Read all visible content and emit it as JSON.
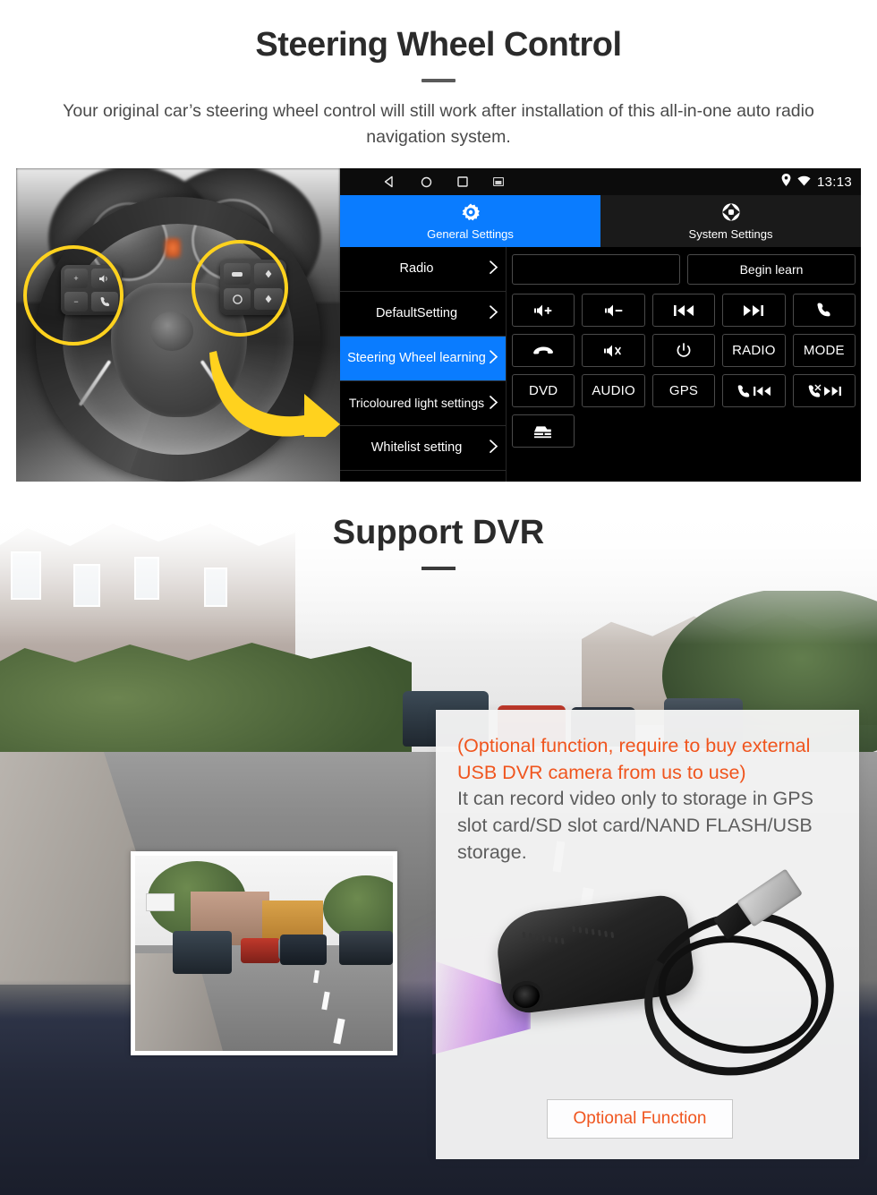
{
  "steering_section": {
    "title": "Steering Wheel Control",
    "description": "Your original car’s steering wheel control will still work after installation of this all-in-one auto radio navigation system.",
    "photo_alt": "steering-wheel-photo"
  },
  "head_unit": {
    "statusbar": {
      "nav_back": "back-icon",
      "nav_home": "home-icon",
      "nav_recents": "recents-icon",
      "nav_screenshot": "screenshot-icon",
      "location_icon": "location-pin-icon",
      "wifi_icon": "wifi-icon",
      "time": "13:13"
    },
    "tabs": [
      {
        "label": "General Settings",
        "icon": "gear-icon",
        "active": true
      },
      {
        "label": "System Settings",
        "icon": "aperture-icon",
        "active": false
      }
    ],
    "menu": [
      {
        "label": "Radio",
        "selected": false
      },
      {
        "label": "DefaultSetting",
        "selected": false
      },
      {
        "label": "Steering Wheel learning",
        "selected": true
      },
      {
        "label": "Tricoloured light settings",
        "selected": false
      },
      {
        "label": "Whitelist setting",
        "selected": false
      }
    ],
    "panel": {
      "input_value": "",
      "input_placeholder": "",
      "begin_learn_label": "Begin learn",
      "keys": [
        {
          "label": "",
          "icon": "volume-up-icon"
        },
        {
          "label": "",
          "icon": "volume-down-icon"
        },
        {
          "label": "",
          "icon": "previous-track-icon"
        },
        {
          "label": "",
          "icon": "next-track-icon"
        },
        {
          "label": "",
          "icon": "call-icon"
        },
        {
          "label": "",
          "icon": "hangup-icon"
        },
        {
          "label": "",
          "icon": "mute-icon"
        },
        {
          "label": "",
          "icon": "power-icon"
        },
        {
          "label": "RADIO",
          "icon": ""
        },
        {
          "label": "MODE",
          "icon": ""
        },
        {
          "label": "DVD",
          "icon": ""
        },
        {
          "label": "AUDIO",
          "icon": ""
        },
        {
          "label": "GPS",
          "icon": ""
        },
        {
          "label": "",
          "icon": "call-previous-icon"
        },
        {
          "label": "",
          "icon": "call-end-next-icon"
        },
        {
          "label": "",
          "icon": "car-icon"
        }
      ]
    },
    "colors": {
      "accent": "#0a7cff",
      "background": "#000000",
      "text": "#ffffff"
    }
  },
  "dvr_section": {
    "title": "Support DVR",
    "info_orange": "(Optional function, require to buy external USB DVR camera from us to use)",
    "info_gray": "It can record video only to storage in GPS slot card/SD slot card/NAND FLASH/USB storage.",
    "optional_button_label": "Optional Function",
    "thumbnail_alt": "dashcam-recording-thumbnail",
    "device_alt": "usb-dvr-camera-photo",
    "colors": {
      "orange": "#F0551E",
      "gray_text": "#5d5d5d",
      "panel_bg": "#f5f5f5"
    }
  }
}
